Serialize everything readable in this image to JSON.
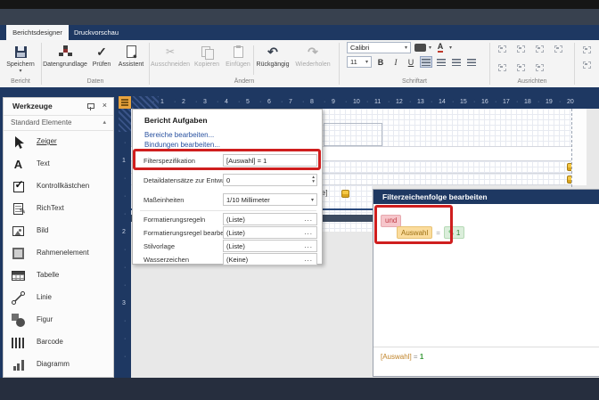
{
  "tabs": {
    "designer": "Berichtsdesigner",
    "preview": "Druckvorschau"
  },
  "ribbon": {
    "bericht": {
      "group": "Bericht",
      "save": "Speichern"
    },
    "daten": {
      "group": "Daten",
      "datengrundlage": "Datengrundlage",
      "pruefen": "Prüfen",
      "assistent": "Assistent"
    },
    "aendern": {
      "group": "Ändern",
      "ausschneiden": "Ausschneiden",
      "kopieren": "Kopieren",
      "einfuegen": "Einfügen",
      "rueckgaengig": "Rückgängig",
      "wiederholen": "Wiederholen"
    },
    "schriftart": {
      "group": "Schriftart",
      "font": "Calibri",
      "size": "11",
      "bold": "B",
      "italic": "I",
      "underline": "U",
      "fontcolor": "A"
    },
    "ausrichten": {
      "group": "Ausrichten"
    }
  },
  "toolbox": {
    "title": "Werkzeuge",
    "section": "Standard Elemente",
    "items": [
      {
        "label": "Zeiger",
        "icon": "cursor-icon"
      },
      {
        "label": "Text",
        "icon": "text-icon"
      },
      {
        "label": "Kontrollkästchen",
        "icon": "checkbox-icon"
      },
      {
        "label": "RichText",
        "icon": "richtext-icon"
      },
      {
        "label": "Bild",
        "icon": "image-icon"
      },
      {
        "label": "Rahmenelement",
        "icon": "frame-icon"
      },
      {
        "label": "Tabelle",
        "icon": "table-icon"
      },
      {
        "label": "Linie",
        "icon": "line-icon"
      },
      {
        "label": "Figur",
        "icon": "shape-icon"
      },
      {
        "label": "Barcode",
        "icon": "barcode-icon"
      },
      {
        "label": "Diagramm",
        "icon": "chart-icon"
      }
    ]
  },
  "ruler": {
    "h_numbers": [
      1,
      2,
      3,
      4,
      5,
      6,
      7,
      8,
      9,
      10,
      11,
      12,
      13,
      14,
      15,
      16,
      17,
      18,
      19,
      20
    ],
    "v_numbers": [
      1,
      2,
      3
    ]
  },
  "popup": {
    "title": "Bericht Aufgaben",
    "link_bereiche": "Bereiche bearbeiten...",
    "link_bindungen": "Bindungen bearbeiten...",
    "ellipsis": "...",
    "rows": [
      {
        "label": "Filterspezifikation",
        "value": "[Auswahl] = 1"
      },
      {
        "label": "Detaildatensätze zur Entwurfszeit",
        "value": "0"
      },
      {
        "label": "Maßeinheiten",
        "value": "1/10 Millimeter"
      },
      {
        "label": "Formatierungsregeln",
        "value": "(Liste)"
      },
      {
        "label": "Formatierungsregel bearbeiten",
        "value": "(Liste)"
      },
      {
        "label": "Stilvorlage",
        "value": "(Liste)"
      },
      {
        "label": "Wasserzeichen",
        "value": "(Keine)"
      }
    ]
  },
  "filter_editor": {
    "title": "Filterzeichenfolge bearbeiten",
    "operator": "und",
    "field": "Auswahl",
    "eq": "=",
    "value": "1",
    "preview_field": "[Auswahl]",
    "preview_eq": "=",
    "preview_value": "1"
  },
  "canvas": {
    "clipped_label": "le]"
  },
  "colors": {
    "navy": "#1e3862",
    "highlight_red": "#cf1e1e",
    "smart_tag_orange": "#e8a33d",
    "operator_badge_bg": "#f6c6cb",
    "field_badge_bg": "#fbdc9c",
    "value_badge_bg": "#dbeedb"
  }
}
